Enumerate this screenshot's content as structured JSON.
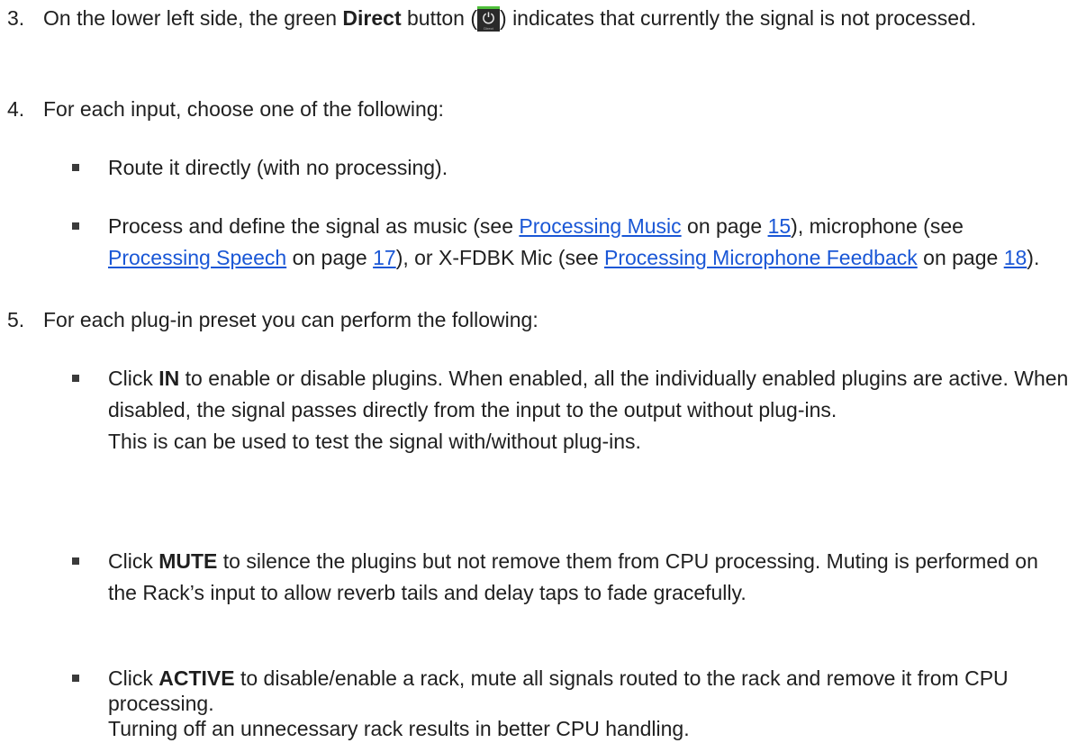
{
  "step3": {
    "number": "3.",
    "text_a": "On the lower left side, the green ",
    "bold": "Direct",
    "text_b": " button (",
    "icon_name": "power-icon",
    "icon_label": "Direct",
    "icon_accent": "#4fbf3a",
    "text_c": ") indicates that currently the signal is not processed."
  },
  "step4": {
    "number": "4.",
    "text": "For each input, choose one of the following:",
    "bullet1": "Route it directly (with no processing).",
    "bullet2": {
      "a": "Process and define the signal as music (see ",
      "link1": "Processing Music",
      "b": " on page ",
      "page1": "15",
      "c": "), microphone (see ",
      "link2": "Processing Speech",
      "d": " on page ",
      "page2": "17",
      "e": "), or X-FDBK Mic (see ",
      "link3": "Processing Microphone Feedback",
      "f": " on page ",
      "page3": "18",
      "g": ")."
    }
  },
  "step5": {
    "number": "5.",
    "text": "For each plug-in preset you can perform the following:",
    "bullet1": {
      "a": "Click ",
      "bold": "IN",
      "b": " to enable or disable plugins. When enabled, all the individually enabled plugins are active. When disabled, the signal passes directly from the input to the output without plug-ins.",
      "line2": "This is can be used to test the signal with/without plug-ins."
    },
    "bullet2": {
      "a": "Click ",
      "bold": "MUTE",
      "b": " to silence the plugins but not remove them from CPU processing. Muting is performed on the Rack’s input to allow reverb tails and delay taps to fade gracefully."
    },
    "bullet3": {
      "a": "Click ",
      "bold": "ACTIVE",
      "b": " to disable/enable a rack, mute all signals routed to the rack and remove it from CPU processing.",
      "line2": "Turning off an unnecessary rack results in better CPU handling."
    }
  }
}
